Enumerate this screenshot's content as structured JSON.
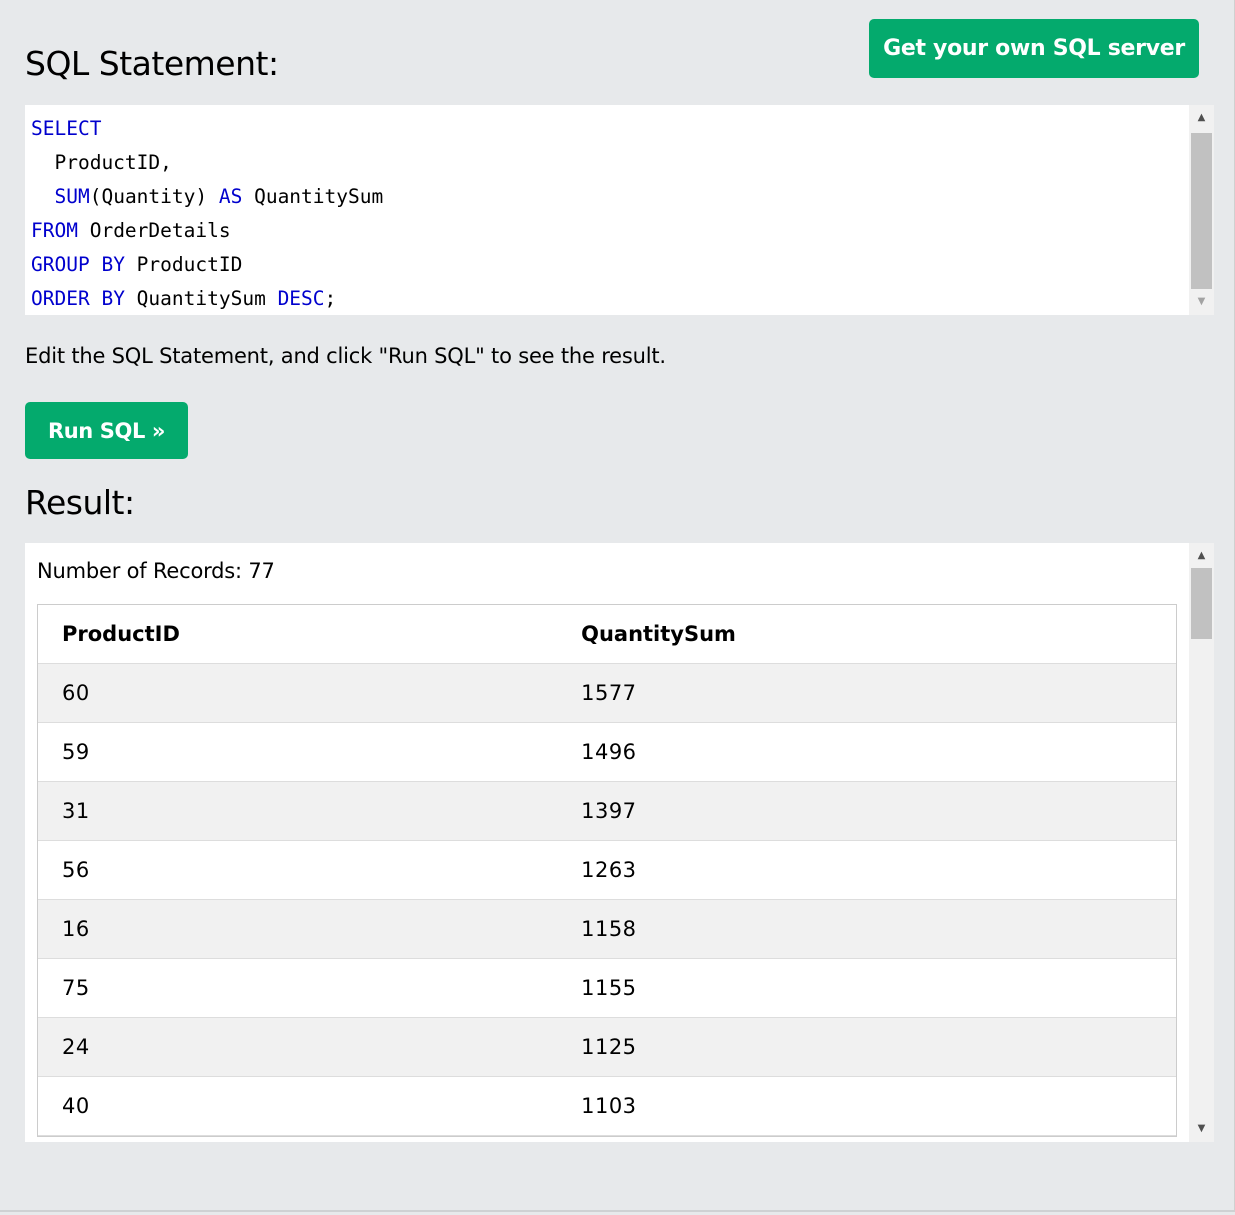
{
  "header": {
    "title": "SQL Statement:",
    "server_button": "Get your own SQL server"
  },
  "editor": {
    "lines": [
      [
        {
          "t": "SELECT",
          "k": true
        }
      ],
      [
        {
          "t": "  ProductID,",
          "k": false
        }
      ],
      [
        {
          "t": "  ",
          "k": false
        },
        {
          "t": "SUM",
          "k": true
        },
        {
          "t": "(Quantity) ",
          "k": false
        },
        {
          "t": "AS",
          "k": true
        },
        {
          "t": " QuantitySum",
          "k": false
        }
      ],
      [
        {
          "t": "FROM",
          "k": true
        },
        {
          "t": " OrderDetails",
          "k": false
        }
      ],
      [
        {
          "t": "GROUP",
          "k": true
        },
        {
          "t": " ",
          "k": false
        },
        {
          "t": "BY",
          "k": true
        },
        {
          "t": " ProductID",
          "k": false
        }
      ],
      [
        {
          "t": "ORDER",
          "k": true
        },
        {
          "t": " ",
          "k": false
        },
        {
          "t": "BY",
          "k": true
        },
        {
          "t": " QuantitySum ",
          "k": false
        },
        {
          "t": "DESC",
          "k": true
        },
        {
          "t": ";",
          "k": false
        }
      ]
    ],
    "keyword_color": "#0000cd"
  },
  "hint": "Edit the SQL Statement, and click \"Run SQL\" to see the result.",
  "run_button": "Run SQL »",
  "result": {
    "title": "Result:",
    "records_label": "Number of Records: 77",
    "columns": [
      "ProductID",
      "QuantitySum"
    ],
    "rows": [
      [
        "60",
        "1577"
      ],
      [
        "59",
        "1496"
      ],
      [
        "31",
        "1397"
      ],
      [
        "56",
        "1263"
      ],
      [
        "16",
        "1158"
      ],
      [
        "75",
        "1155"
      ],
      [
        "24",
        "1125"
      ],
      [
        "40",
        "1103"
      ]
    ]
  },
  "colors": {
    "accent": "#04aa6d",
    "page_bg": "#e7e9eb"
  }
}
